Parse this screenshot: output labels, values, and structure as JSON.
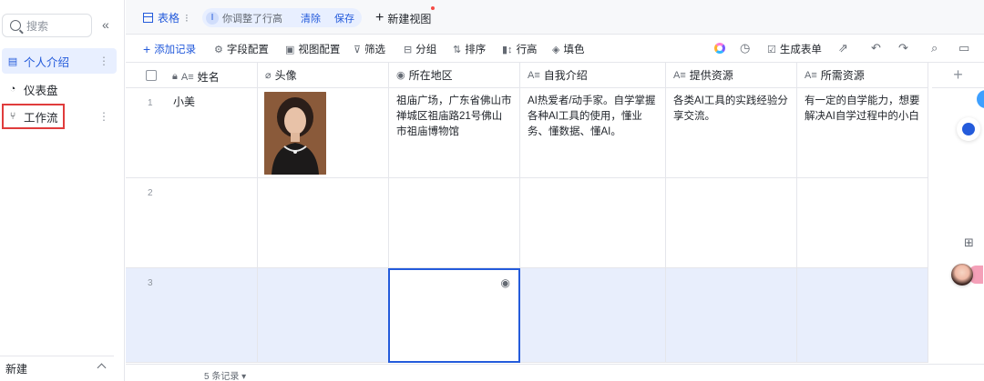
{
  "sidebar": {
    "search_placeholder": "搜索",
    "collapse": "«",
    "items": [
      {
        "label": "个人介绍",
        "active": true
      },
      {
        "label": "仪表盘",
        "active": false
      },
      {
        "label": "工作流",
        "active": false
      }
    ],
    "more": "⋮",
    "bottom_label": "新建"
  },
  "tabbar": {
    "table_tab": "表格",
    "tab_dots": "⁝",
    "modified_text": "你调整了行高",
    "clear": "清除",
    "save": "保存",
    "new_view": "新建视图"
  },
  "toolbar": {
    "add_record": "添加记录",
    "field_config": "字段配置",
    "view_config": "视图配置",
    "filter": "筛选",
    "group": "分组",
    "sort": "排序",
    "row_height": "行高",
    "fill_color": "填色",
    "generate_form": "生成表单"
  },
  "columns": [
    {
      "label": "姓名",
      "icon": "text-icon"
    },
    {
      "label": "头像",
      "icon": "attachment-icon"
    },
    {
      "label": "所在地区",
      "icon": "location-icon"
    },
    {
      "label": "自我介绍",
      "icon": "text-icon"
    },
    {
      "label": "提供资源",
      "icon": "text-icon"
    },
    {
      "label": "所需资源",
      "icon": "text-icon"
    }
  ],
  "rows": [
    {
      "num": "1",
      "name": "小美",
      "region": "祖庙广场，广东省佛山市禅城区祖庙路21号佛山市祖庙博物馆",
      "intro": "AI热爱者/动手家。自学掌握各种AI工具的使用，懂业务、懂数据、懂AI。",
      "provide": "各类AI工具的实践经验分享交流。",
      "need": "有一定的自学能力，想要解决AI自学过程中的小白"
    },
    {
      "num": "2",
      "name": "",
      "region": "",
      "intro": "",
      "provide": "",
      "need": ""
    },
    {
      "num": "3",
      "name": "",
      "region": "",
      "intro": "",
      "provide": "",
      "need": ""
    }
  ],
  "footer": {
    "record_count": "5 条记录"
  }
}
